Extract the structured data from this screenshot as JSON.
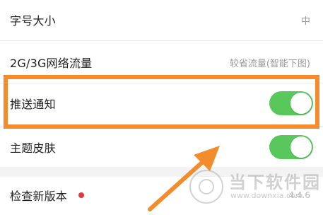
{
  "settings": {
    "font_size": {
      "label": "字号大小",
      "value": "中"
    },
    "network_traffic": {
      "label": "2G/3G网络流量",
      "value": "较省流量(智能下图)"
    },
    "push_notifications": {
      "label": "推送通知",
      "enabled": true
    },
    "theme_skin": {
      "label": "主题皮肤",
      "enabled": true
    },
    "check_update": {
      "label": "检查新版本",
      "version": "4.4.6",
      "has_update_dot": true
    }
  },
  "annotation": {
    "highlight_color": "#f28c2d",
    "arrow_color": "#f28c2d"
  },
  "watermark": {
    "title": "当下软件园",
    "url": "www.downxia.com"
  },
  "colors": {
    "toggle_on": "#58c85c",
    "update_dot": "#e23b3b"
  }
}
